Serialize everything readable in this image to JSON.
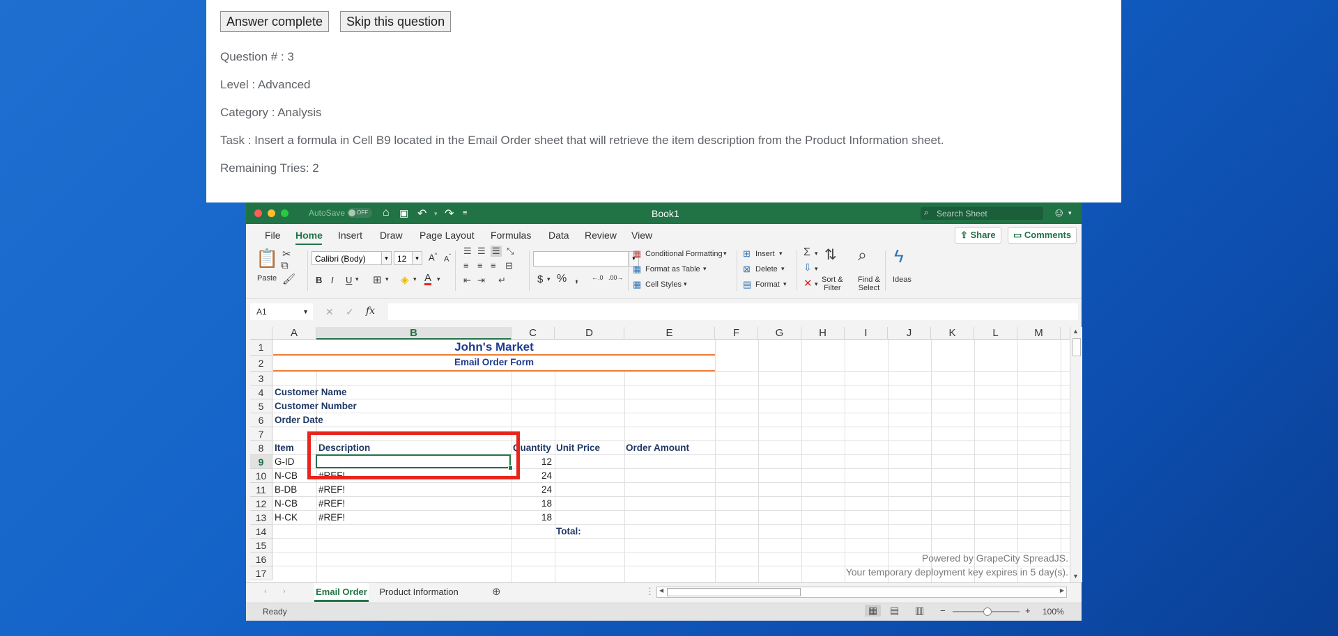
{
  "question": {
    "buttons": {
      "answer_complete": "Answer complete",
      "skip": "Skip this question"
    },
    "number": "Question # : 3",
    "level": "Level : Advanced",
    "category": "Category : Analysis",
    "task": "Task : Insert a formula in Cell B9 located in the Email Order sheet that will retrieve the item description from the Product Information sheet.",
    "remaining": "Remaining Tries: 2"
  },
  "titlebar": {
    "autosave": "AutoSave",
    "autosave_state": "OFF",
    "title": "Book1",
    "search_placeholder": "Search Sheet"
  },
  "menu": {
    "items": [
      "File",
      "Home",
      "Insert",
      "Draw",
      "Page Layout",
      "Formulas",
      "Data",
      "Review",
      "View"
    ],
    "active": "Home",
    "share": "Share",
    "comments": "Comments"
  },
  "ribbon": {
    "paste": "Paste",
    "font_name": "Calibri (Body)",
    "font_size": "12",
    "conditional_formatting": "Conditional Formatting",
    "format_as_table": "Format as Table",
    "cell_styles": "Cell Styles",
    "insert": "Insert",
    "delete": "Delete",
    "format": "Format",
    "sort_filter": [
      "Sort &",
      "Filter"
    ],
    "find_select": [
      "Find &",
      "Select"
    ],
    "ideas": "Ideas",
    "bold": "B",
    "italic": "I",
    "underline": "U",
    "dollar": "$",
    "percent": "%",
    "comma": ","
  },
  "formula_bar": {
    "name_box": "A1",
    "fx": "fx",
    "value": ""
  },
  "sheet": {
    "columns": [
      "A",
      "B",
      "C",
      "D",
      "E",
      "F",
      "G",
      "H",
      "I",
      "J",
      "K",
      "L",
      "M"
    ],
    "selected_column": "B",
    "selected_row": "9",
    "rows": [
      "1",
      "2",
      "3",
      "4",
      "5",
      "6",
      "7",
      "8",
      "9",
      "10",
      "11",
      "12",
      "13",
      "14",
      "15",
      "16",
      "17"
    ],
    "title": "John's Market",
    "subtitle": "Email Order Form",
    "labels": {
      "customer_name": "Customer Name",
      "customer_number": "Customer Number",
      "order_date": "Order Date"
    },
    "headers": {
      "item": "Item",
      "description": "Description",
      "quantity": "Quantity",
      "unit_price": "Unit Price",
      "order_amount": "Order Amount"
    },
    "data_rows": [
      {
        "item": "G-ID",
        "description": "",
        "quantity": "12"
      },
      {
        "item": "N-CB",
        "description": "#REF!",
        "quantity": "24"
      },
      {
        "item": "B-DB",
        "description": "#REF!",
        "quantity": "24"
      },
      {
        "item": "N-CB",
        "description": "#REF!",
        "quantity": "18"
      },
      {
        "item": "H-CK",
        "description": "#REF!",
        "quantity": "18"
      }
    ],
    "total_label": "Total:",
    "watermark_1": "Powered by GrapeCity SpreadJS.",
    "watermark_2": "Your temporary deployment key expires in 5 day(s)."
  },
  "tabs": {
    "items": [
      "Email Order",
      "Product Information"
    ],
    "active": "Email Order"
  },
  "status": {
    "ready": "Ready",
    "zoom": "100%"
  },
  "colors": {
    "excel_green": "#217346",
    "highlight_red": "#e8251d",
    "orange_rule": "#ed7d31",
    "label_navy": "#1f3864"
  }
}
